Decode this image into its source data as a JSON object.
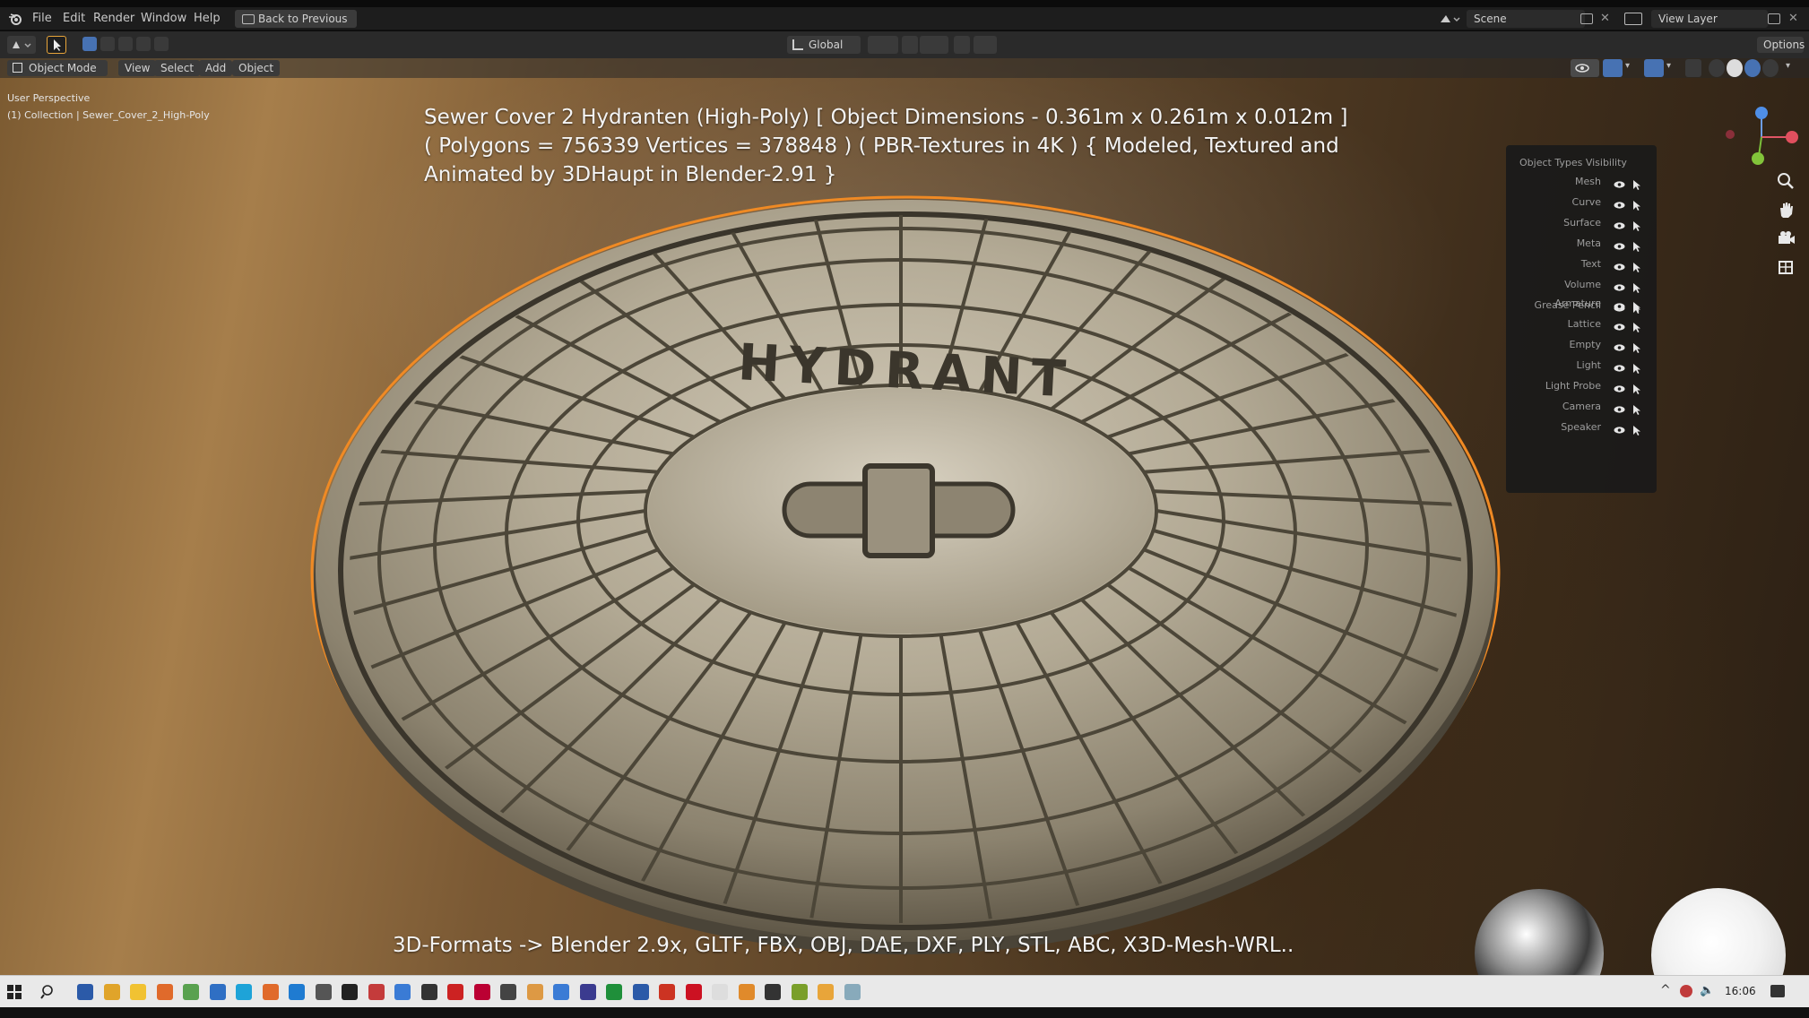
{
  "topbar": {
    "menus": [
      "File",
      "Edit",
      "Render",
      "Window",
      "Help"
    ],
    "back_label": "Back to Previous",
    "scene_label": "Scene",
    "view_layer_label": "View Layer"
  },
  "header": {
    "transform_orientation": "Global",
    "options_label": "Options"
  },
  "toolbar": {
    "mode_label": "Object Mode",
    "menus": [
      "View",
      "Select",
      "Add",
      "Object"
    ]
  },
  "viewport": {
    "perspective_label": "User Perspective",
    "collection_label": "(1) Collection | Sewer_Cover_2_High-Poly"
  },
  "caption": {
    "line1": "Sewer Cover 2 Hydranten (High-Poly) [ Object Dimensions -  0.361m x 0.261m x 0.012m ]",
    "line2": "( Polygons = 756339 Vertices = 378848 ) ( PBR-Textures in 4K ) { Modeled, Textured and",
    "line3": "Animated by 3DHaupt in Blender-2.91 }"
  },
  "formats_line": "3D-Formats -> Blender 2.9x, GLTF, FBX, OBJ, DAE, DXF, PLY, STL, ABC, X3D-Mesh-WRL..",
  "object_types_panel": {
    "title": "Object Types Visibility",
    "group1": [
      "Mesh",
      "Curve",
      "Surface",
      "Meta",
      "Text",
      "Volume",
      "Grease Pencil"
    ],
    "group2": [
      "Armature",
      "Lattice",
      "Empty",
      "Light",
      "Light Probe",
      "Camera",
      "Speaker"
    ]
  },
  "cover_text": "HYDRANT",
  "taskbar": {
    "clock": "16:06"
  },
  "colors": {
    "selection_outline": "#f08a24",
    "header_active": "#4772b3"
  }
}
